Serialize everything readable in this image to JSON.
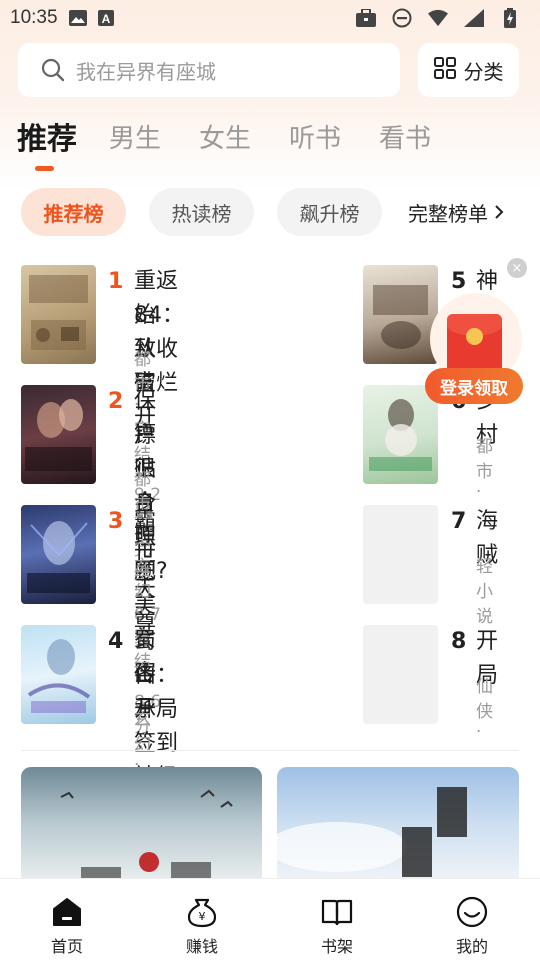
{
  "status_bar": {
    "time": "10:35",
    "icons_left": [
      "image-icon",
      "a-icon"
    ],
    "icons_right": [
      "briefcase-icon",
      "dnd-icon",
      "wifi-icon",
      "signal-icon",
      "battery-icon"
    ]
  },
  "search": {
    "placeholder": "我在异界有座城"
  },
  "category": {
    "label": "分类"
  },
  "tabs": [
    {
      "label": "推荐",
      "active": true
    },
    {
      "label": "男生",
      "active": false
    },
    {
      "label": "女生",
      "active": false
    },
    {
      "label": "听书",
      "active": false
    },
    {
      "label": "看书",
      "active": false
    }
  ],
  "chips": [
    {
      "label": "推荐榜",
      "active": true
    },
    {
      "label": "热读榜",
      "active": false
    },
    {
      "label": "飙升榜",
      "active": false
    }
  ],
  "full_list": {
    "label": "完整榜单"
  },
  "books_left": [
    {
      "rank": "1",
      "title_line1": "重返84：从收破烂开",
      "title_line2": "始致富",
      "meta": "都市 · 完结 · 9.2分"
    },
    {
      "rank": "2",
      "title_line1": "保镖贴身照顾美女客",
      "title_line2": "户很合理吧?",
      "meta": "都市 · 完结 · 8.7分"
    },
    {
      "rank": "3",
      "title_line1": "霸世天尊",
      "title_line2": "",
      "meta": "玄幻 · 完结 · 8.6分"
    },
    {
      "rank": "4",
      "title_line1": "蜀山：开局签到神级",
      "title_line2": "传承",
      "meta": "玄幻 · 完结 · 9.0分"
    }
  ],
  "books_right": [
    {
      "rank": "5",
      "title": "神话",
      "meta": ""
    },
    {
      "rank": "6",
      "title": "乡村",
      "meta": "都市 ·"
    },
    {
      "rank": "7",
      "title": "海贼",
      "meta": "轻小说"
    },
    {
      "rank": "8",
      "title": "开局",
      "meta": "仙侠 ·"
    }
  ],
  "promo": {
    "label": "登录领取",
    "close": "×"
  },
  "nav": [
    {
      "label": "首页",
      "icon": "home-icon"
    },
    {
      "label": "赚钱",
      "icon": "money-bag-icon"
    },
    {
      "label": "书架",
      "icon": "bookshelf-icon"
    },
    {
      "label": "我的",
      "icon": "profile-icon"
    }
  ],
  "colors": {
    "accent": "#f0541e",
    "chip_active_bg": "#fde3d6",
    "promo_red": "#e83a2e"
  }
}
